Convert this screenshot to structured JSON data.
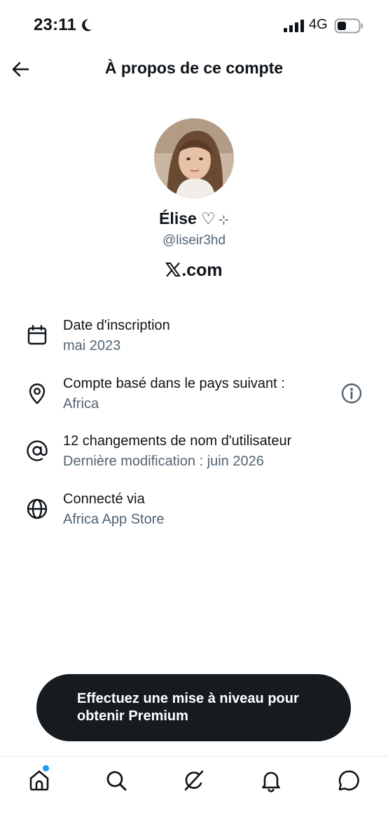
{
  "status_bar": {
    "time": "23:11",
    "network": "4G",
    "icons": [
      "moon-icon",
      "signal-icon",
      "battery-icon"
    ]
  },
  "header": {
    "back_icon": "arrow-left-icon",
    "title": "À propos de ce compte"
  },
  "profile": {
    "name": "Élise ♡",
    "name_sparkle": "⊹",
    "handle": "@liseir3hd",
    "site": ".com",
    "site_logo": "x-logo-icon"
  },
  "info": [
    {
      "icon": "calendar-icon",
      "title": "Date d'inscription",
      "subtitle": "mai 2023"
    },
    {
      "icon": "location-pin-icon",
      "title": "Compte basé dans le pays suivant :",
      "subtitle": "Africa",
      "action_icon": "info-icon"
    },
    {
      "icon": "at-sign-icon",
      "title": "12 changements de nom d'utilisateur",
      "subtitle": "Dernière modification : juin 2026"
    },
    {
      "icon": "globe-icon",
      "title": "Connecté via",
      "subtitle": "Africa App Store"
    }
  ],
  "premium": {
    "text": "Effectuez une mise à niveau pour obtenir Premium"
  },
  "nav": {
    "items": [
      "home-icon",
      "search-icon",
      "grok-icon",
      "bell-icon",
      "messages-icon"
    ],
    "accent": "#1d9bf0"
  },
  "colors": {
    "text": "#0f1419",
    "secondary": "#536471",
    "banner": "#161b20"
  }
}
